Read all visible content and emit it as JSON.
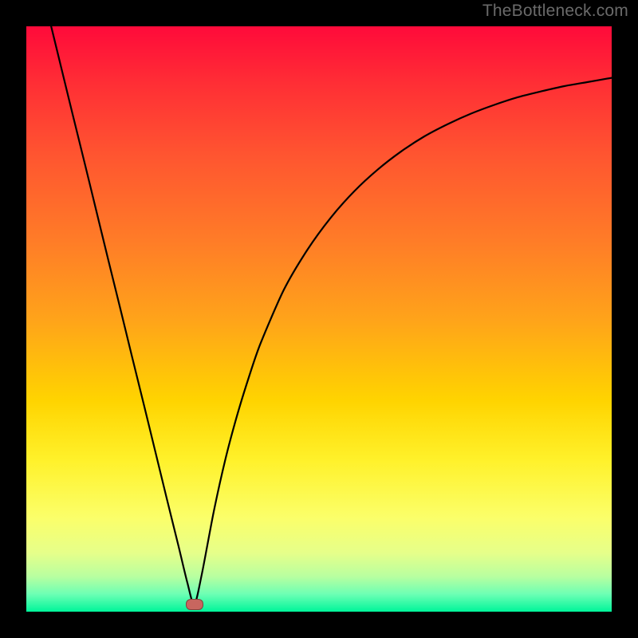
{
  "watermark": "TheBottleneck.com",
  "icons": {
    "marker": "marker-icon"
  },
  "chart_data": {
    "type": "line",
    "title": "",
    "xlabel": "",
    "ylabel": "",
    "xlim": [
      0,
      100
    ],
    "ylim": [
      0,
      100
    ],
    "grid": false,
    "legend": false,
    "marker": {
      "x": 28.7,
      "y": 1.2,
      "color": "#c8665f"
    },
    "series": [
      {
        "name": "curve",
        "color": "#000000",
        "x": [
          4.0,
          6.0,
          8.0,
          10.0,
          12.0,
          14.0,
          16.0,
          18.0,
          20.0,
          22.0,
          24.0,
          26.0,
          27.5,
          28.7,
          30.0,
          32.0,
          34.0,
          36.0,
          38.0,
          40.0,
          44.0,
          48.0,
          52.0,
          56.0,
          60.0,
          64.0,
          68.0,
          72.0,
          76.0,
          80.0,
          84.0,
          88.0,
          92.0,
          96.0,
          100.0
        ],
        "y": [
          101.0,
          92.8,
          84.6,
          76.5,
          68.3,
          60.1,
          52.0,
          43.8,
          35.7,
          27.5,
          19.3,
          11.2,
          5.0,
          1.2,
          6.5,
          17.0,
          26.0,
          33.5,
          40.0,
          45.8,
          55.0,
          61.8,
          67.3,
          71.8,
          75.5,
          78.6,
          81.2,
          83.3,
          85.1,
          86.6,
          87.9,
          88.9,
          89.8,
          90.5,
          91.2
        ]
      }
    ]
  }
}
